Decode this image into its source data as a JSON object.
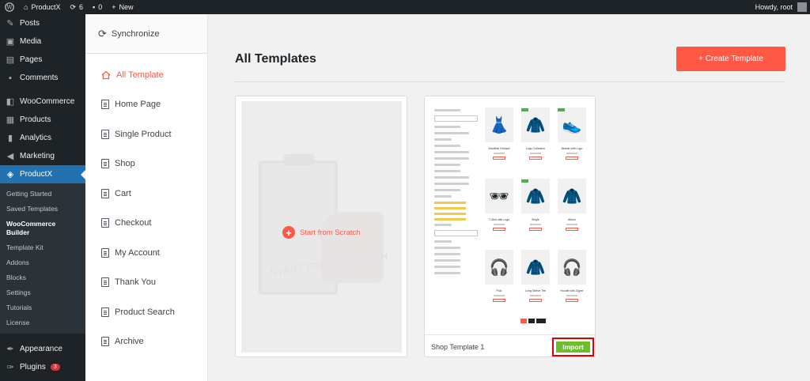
{
  "adminbar": {
    "site_name": "ProductX",
    "updates_count": "6",
    "comments_count": "0",
    "new_label": "New",
    "greeting": "Howdy, root"
  },
  "adminmenu": {
    "items_top": [
      {
        "label": "Posts",
        "icon": "pushpin-icon"
      },
      {
        "label": "Media",
        "icon": "media-icon"
      },
      {
        "label": "Pages",
        "icon": "pages-icon"
      },
      {
        "label": "Comments",
        "icon": "comments-icon"
      }
    ],
    "items_mid": [
      {
        "label": "WooCommerce",
        "icon": "woocommerce-icon"
      },
      {
        "label": "Products",
        "icon": "products-icon"
      },
      {
        "label": "Analytics",
        "icon": "analytics-icon"
      },
      {
        "label": "Marketing",
        "icon": "marketing-icon"
      }
    ],
    "active": {
      "label": "ProductX",
      "icon": "productx-icon"
    },
    "submenu": [
      "Getting Started",
      "Saved Templates",
      "WooCommerce Builder",
      "Template Kit",
      "Addons",
      "Blocks",
      "Settings",
      "Tutorials",
      "License"
    ],
    "items_bottom": [
      {
        "label": "Appearance",
        "icon": "appearance-icon"
      },
      {
        "label": "Plugins",
        "icon": "plugins-icon",
        "badge": "3"
      }
    ]
  },
  "template_sidebar": {
    "sync_label": "Synchronize",
    "items": [
      "All Template",
      "Home Page",
      "Single Product",
      "Shop",
      "Cart",
      "Checkout",
      "My Account",
      "Thank You",
      "Product Search",
      "Archive"
    ]
  },
  "main": {
    "title": "All Templates",
    "create_button": "+ Create Template",
    "scratch_card": {
      "label": "Start from Scratch",
      "art_text": "START FROM SCRATCH"
    },
    "shop_card": {
      "name": "Shop Template 1",
      "import_label": "Import",
      "products": [
        {
          "name": "Woolfnte Hmnpot",
          "emoji": "👗"
        },
        {
          "name": "Logo Collection",
          "emoji": "🧥"
        },
        {
          "name": "Beanie with Logo",
          "emoji": "👟"
        },
        {
          "name": "T-Shirt with Logo",
          "emoji": "🕶"
        },
        {
          "name": "Single",
          "emoji": "🧥"
        },
        {
          "name": "Album",
          "emoji": "🧥"
        },
        {
          "name": "Polo",
          "emoji": "🎧"
        },
        {
          "name": "Long Sleeve Tee",
          "emoji": "🧥"
        },
        {
          "name": "Hoodie with Zipper",
          "emoji": "🎧"
        }
      ]
    }
  },
  "colors": {
    "accent": "#ff5845",
    "wp_blue": "#2271b1",
    "import_green": "#6cbe2b",
    "highlight_red": "#e00000"
  }
}
